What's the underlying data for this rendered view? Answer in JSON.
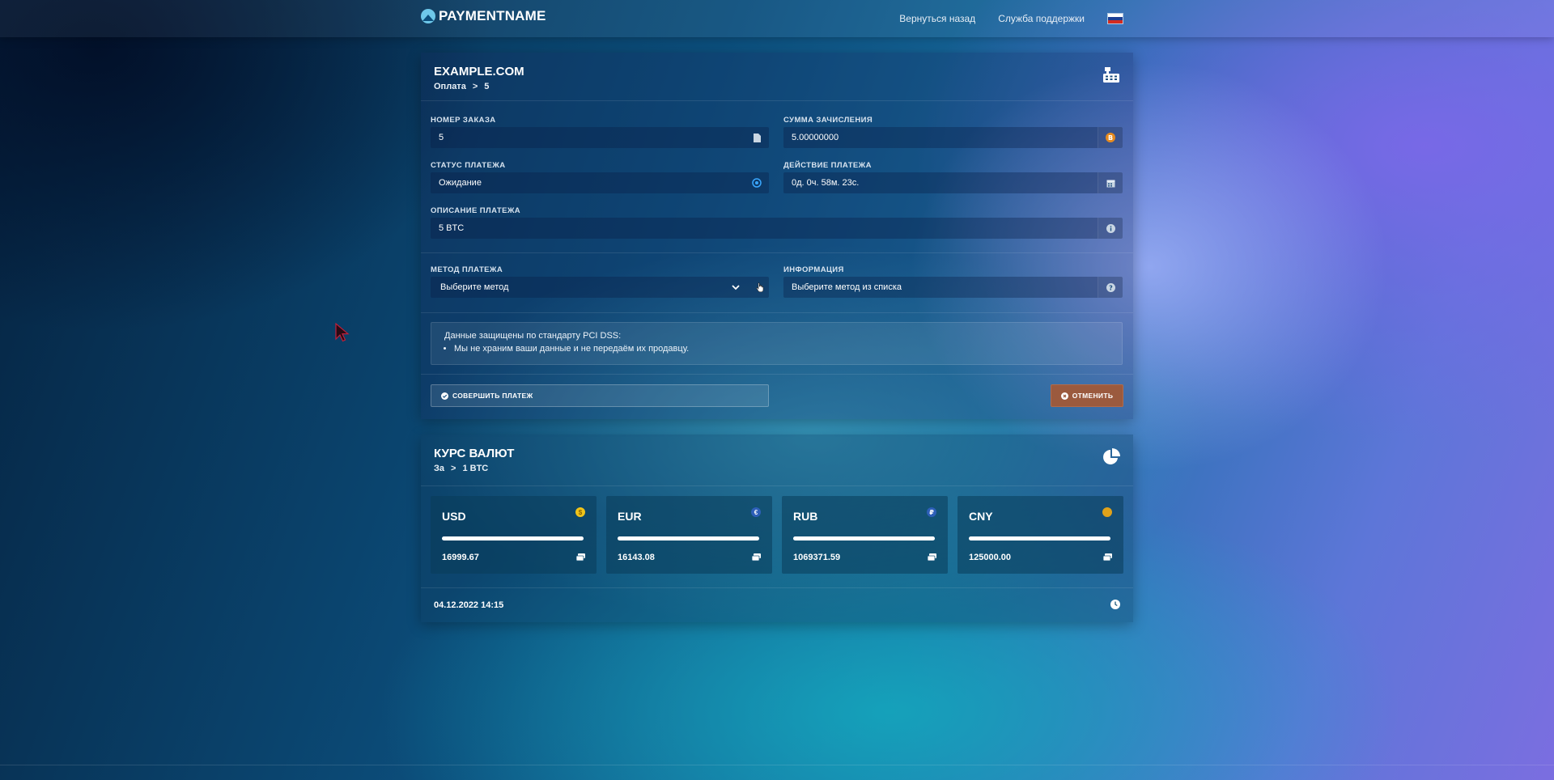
{
  "brand": {
    "name": "PAYMENTNAME"
  },
  "nav": {
    "back": "Вернуться назад",
    "support": "Служба поддержки",
    "language_icon": "russia-flag-icon"
  },
  "colors": {
    "accent_orange": "#e58a1f",
    "cancel_button": "#9b5a3e",
    "usd_coin": "#f0c419",
    "eur_coin": "#2d5fb8",
    "rub_coin": "#2d5fb8",
    "cny_coin": "#e0a21a"
  },
  "payment": {
    "title": "EXAMPLE.COM",
    "breadcrumb": {
      "first": "Оплата",
      "separator": ">",
      "second": "5"
    },
    "icon": "cash-register-icon",
    "order_number": {
      "label": "Номер заказа",
      "value": "5",
      "icon": "file-icon"
    },
    "credit_amount": {
      "label": "Сумма зачисления",
      "value": "5.00000000",
      "icon": "bitcoin-icon"
    },
    "status": {
      "label": "Статус платежа",
      "value": "Ожидание",
      "icon": "target-icon"
    },
    "validity": {
      "label": "Действие платежа",
      "value": "0д. 0ч. 58м. 23с.",
      "icon": "calendar-icon"
    },
    "description": {
      "label": "Описание платежа",
      "value": "5 BTC",
      "icon": "info-icon"
    },
    "method": {
      "label": "Метод платежа",
      "selected": "Выберите метод",
      "icon": "hand-pointer-icon"
    },
    "info": {
      "label": "Информация",
      "value": "Выберите метод из списка",
      "icon": "question-icon"
    },
    "notice": {
      "title": "Данные защищены по стандарту PCI DSS:",
      "items": [
        "Мы не храним ваши данные и не передаём их продавцу."
      ]
    },
    "pay_button": "Совершить платеж",
    "cancel_button": "Отменить"
  },
  "rates": {
    "title": "КУРС ВАЛЮТ",
    "breadcrumb": {
      "first": "За",
      "separator": ">",
      "second": "1 BTC"
    },
    "icon": "pie-chart-icon",
    "currencies": [
      {
        "code": "USD",
        "symbol": "$",
        "amount": "16999.67",
        "progress": 1.0
      },
      {
        "code": "EUR",
        "symbol": "€",
        "amount": "16143.08",
        "progress": 1.0
      },
      {
        "code": "RUB",
        "symbol": "₽",
        "amount": "1069371.59",
        "progress": 1.0
      },
      {
        "code": "CNY",
        "symbol": "",
        "amount": "125000.00",
        "progress": 1.0
      }
    ],
    "updated": "04.12.2022 14:15",
    "clock_icon": "clock-icon"
  }
}
